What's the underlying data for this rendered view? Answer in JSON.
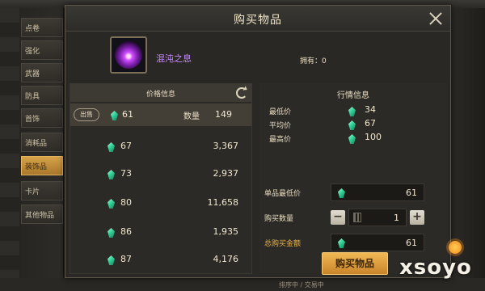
{
  "background": {
    "tabs": [
      "点卷",
      "强化",
      "武器",
      "防具",
      "首饰",
      "消耗品",
      "装饰品",
      "卡片",
      "其他物品"
    ],
    "active_tab_index": 6,
    "bottom_text": "排序中 / 交易中"
  },
  "dialog": {
    "title": "购买物品",
    "item": {
      "name": "混沌之息",
      "icon": "chaos-orb-icon"
    },
    "owned_label": "拥有：0",
    "price_panel": {
      "header": "价格信息",
      "sell_badge": "出售",
      "qty_label": "数量",
      "selected": {
        "price": "61",
        "qty": "149"
      },
      "rows": [
        {
          "price": "67",
          "qty": "3,367"
        },
        {
          "price": "73",
          "qty": "2,937"
        },
        {
          "price": "80",
          "qty": "11,658"
        },
        {
          "price": "86",
          "qty": "1,935"
        },
        {
          "price": "87",
          "qty": "4,176"
        }
      ]
    },
    "market_panel": {
      "title": "行情信息",
      "stats": [
        {
          "label": "最低价",
          "value": "34"
        },
        {
          "label": "平均价",
          "value": "67"
        },
        {
          "label": "最高价",
          "value": "100"
        }
      ]
    },
    "form": {
      "unit_min_label": "单品最低价",
      "unit_min_value": "61",
      "qty_label": "购买数量",
      "qty_value": "1",
      "minus": "−",
      "plus": "+",
      "total_label": "总购买金额",
      "total_value": "61"
    },
    "buy_button": "购买物品"
  },
  "watermark": {
    "text": "xsoyo"
  },
  "colors": {
    "accent": "#e6b24f",
    "currency_gem": "#35d19a",
    "item_name": "#c88cff"
  }
}
